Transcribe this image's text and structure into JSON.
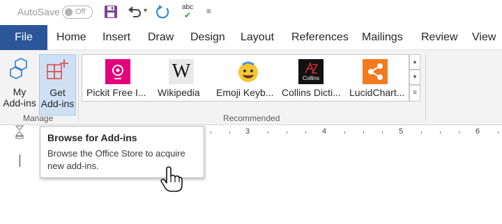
{
  "qat": {
    "autosave_label": "AutoSave",
    "autosave_state": "Off",
    "save_icon": "save-icon",
    "undo_icon": "undo-icon",
    "redo_icon": "redo-icon",
    "spelling_icon": "spelling-check-icon",
    "spelling_text": "abc",
    "customize_glyph": "≡"
  },
  "tabs": {
    "file": "File",
    "home": "Home",
    "insert": "Insert",
    "draw": "Draw",
    "design": "Design",
    "layout": "Layout",
    "references": "References",
    "mailings": "Mailings",
    "review": "Review",
    "view": "View"
  },
  "ribbon": {
    "my_addins_line1": "My",
    "my_addins_line2": "Add-ins",
    "get_addins_line1": "Get",
    "get_addins_line2": "Add-ins",
    "manage_group": "Manage",
    "recommended_group": "Recommended",
    "recommended": [
      {
        "name": "Pickit Free I...",
        "icon": "pickit-icon"
      },
      {
        "name": "Wikipedia",
        "icon": "wikipedia-icon",
        "logo_text": "W"
      },
      {
        "name": "Emoji Keyb...",
        "icon": "emoji-icon"
      },
      {
        "name": "Collins Dicti...",
        "icon": "collins-icon",
        "logo_text": "Collins"
      },
      {
        "name": "LucidChart...",
        "icon": "lucidchart-icon"
      }
    ]
  },
  "ruler": {
    "numbers": [
      "3",
      "4",
      "5",
      "6"
    ]
  },
  "tooltip": {
    "title": "Browse for Add-ins",
    "body": "Browse the Office Store to acquire new add-ins."
  },
  "colors": {
    "file_tab": "#2b579a",
    "ribbon_bg": "#f3f3f3",
    "active_button": "#cfe0f4",
    "save_purple": "#7b3f99",
    "redo_blue": "#2e8bd6",
    "pickit_pink": "#e4007c",
    "lucid_orange": "#f47a20"
  }
}
